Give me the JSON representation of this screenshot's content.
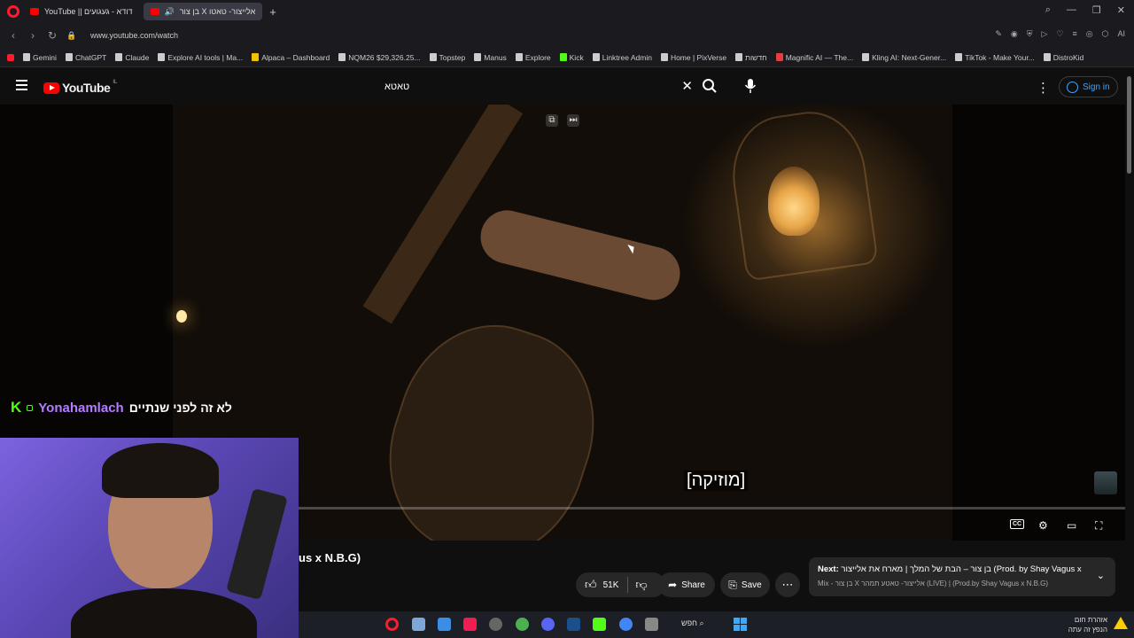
{
  "browser": {
    "tabs": [
      {
        "title": "YouTube || דודא - געגועים",
        "active": false
      },
      {
        "title": "בן צור X אלייצור- טאטו",
        "active": true
      }
    ],
    "url": "www.youtube.com/watch",
    "bookmarks": [
      "Gemini",
      "ChatGPT",
      "Claude",
      "Explore AI tools | Ma...",
      "Alpaca – Dashboard",
      "NQM26 $29,326.25...",
      "Topstep",
      "Manus",
      "Explore",
      "Kick",
      "Linktree Admin",
      "Home | PixVerse",
      "חדשות",
      "Magnific AI — The...",
      "Kling AI: Next-Gener...",
      "TikTok - Make Your...",
      "DistroKid"
    ],
    "address_right_label": "AI"
  },
  "youtube": {
    "logo_text": "YouTube",
    "country_code": "IL",
    "search_value": "טאטא",
    "signin_label": "Sign in"
  },
  "video": {
    "subtitle": "[מוזיקה]",
    "title_fragment": "us x N.B.G)"
  },
  "chat": {
    "username": "Yonahamlach",
    "message": "לא זה לפני שנתיים"
  },
  "actions": {
    "like_count": "51K",
    "share_label": "Share",
    "save_label": "Save"
  },
  "next_card": {
    "label": "Next:",
    "title": "בן צור – הבת של המלך | מארח את אלייצור (Prod. by Shay Vagus x N...",
    "subtitle": "Mix - בן צור X אלייצור- טאטע תמהר (LIVE) | (Prod.by Shay Vagus x N.B.G)"
  },
  "taskbar": {
    "search_label": "חפש",
    "notice_line1": "אזהרת חום",
    "notice_line2": "הנפץ זה עתה"
  },
  "colors": {
    "yt_red": "#ff0000",
    "kick_green": "#53fc18",
    "link_blue": "#3ea6ff",
    "chat_user": "#b57cff"
  }
}
